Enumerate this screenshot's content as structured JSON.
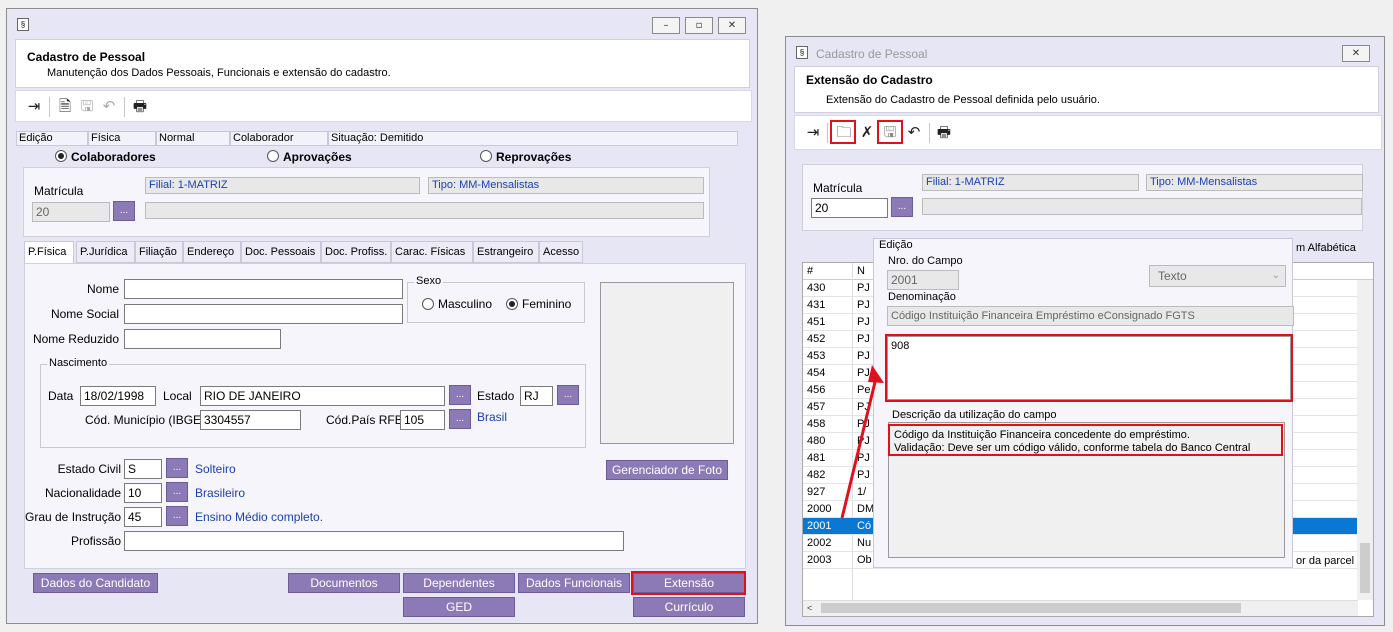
{
  "left": {
    "header": {
      "title": "Cadastro de Pessoal",
      "subtitle": "Manutenção dos Dados Pessoais, Funcionais e extensão do cadastro."
    },
    "status": [
      "Edição",
      "Física",
      "Normal",
      "Colaborador",
      "Situação: Demitido"
    ],
    "radios": [
      "Colaboradores",
      "Aprovações",
      "Reprovações"
    ],
    "matricula": {
      "label": "Matrícula",
      "value": "20",
      "filial": "Filial: 1-MATRIZ",
      "tipo": "Tipo: MM-Mensalistas"
    },
    "tabs": [
      "P.Física",
      "P.Jurídica",
      "Filiação",
      "Endereço",
      "Doc. Pessoais",
      "Doc. Profiss.",
      "Carac. Físicas",
      "Estrangeiro",
      "Acesso"
    ],
    "form": {
      "nome_label": "Nome",
      "nome_social_label": "Nome Social",
      "nome_reduzido_label": "Nome Reduzido",
      "sexo_label": "Sexo",
      "masculino": "Masculino",
      "feminino": "Feminino",
      "nascimento_label": "Nascimento",
      "data_label": "Data",
      "data_value": "18/02/1998",
      "local_label": "Local",
      "local_value": "RIO DE JANEIRO",
      "estado_label": "Estado",
      "estado_value": "RJ",
      "municipio_label": "Cód. Município (IBGE)",
      "municipio_value": "3304557",
      "pais_label": "Cód.País RFB",
      "pais_value": "105",
      "pais_desc": "Brasil",
      "estado_civil_label": "Estado Civil",
      "estado_civil_value": "S",
      "estado_civil_desc": "Solteiro",
      "nacionalidade_label": "Nacionalidade",
      "nacionalidade_value": "10",
      "nacionalidade_desc": "Brasileiro",
      "grau_label": "Grau de Instrução",
      "grau_value": "45",
      "grau_desc": "Ensino Médio completo.",
      "profissao_label": "Profissão",
      "foto_button": "Gerenciador de Foto"
    },
    "buttons": {
      "dados_candidato": "Dados do Candidato",
      "documentos": "Documentos",
      "dependentes": "Dependentes",
      "dados_funcionais": "Dados Funcionais",
      "extensao": "Extensão",
      "ged": "GED",
      "curriculo": "Currículo"
    },
    "lookup_glyph": "..."
  },
  "right": {
    "window_title": "Cadastro de Pessoal",
    "header": {
      "title": "Extensão do Cadastro",
      "subtitle": "Extensão do Cadastro de Pessoal definida pelo usuário."
    },
    "matricula": {
      "label": "Matrícula",
      "value": "20",
      "filial": "Filial: 1-MATRIZ",
      "tipo": "Tipo: MM-Mensalistas"
    },
    "grid": {
      "col_num": "#",
      "col_n": "N",
      "right_header": "m Alfabética",
      "rows": [
        {
          "num": "430",
          "n": "PJ"
        },
        {
          "num": "431",
          "n": "PJ"
        },
        {
          "num": "451",
          "n": "PJ"
        },
        {
          "num": "452",
          "n": "PJ"
        },
        {
          "num": "453",
          "n": "PJ"
        },
        {
          "num": "454",
          "n": "PJ"
        },
        {
          "num": "456",
          "n": "Pe"
        },
        {
          "num": "457",
          "n": "PJ"
        },
        {
          "num": "458",
          "n": "PJ"
        },
        {
          "num": "480",
          "n": "PJ"
        },
        {
          "num": "481",
          "n": "PJ"
        },
        {
          "num": "482",
          "n": "PJ"
        },
        {
          "num": "927",
          "n": "1/"
        },
        {
          "num": "2000",
          "n": "DM"
        },
        {
          "num": "2001",
          "n": "Có"
        },
        {
          "num": "2002",
          "n": "Nu"
        },
        {
          "num": "2003",
          "n": "Ob"
        }
      ],
      "right_last": "or da parcel"
    },
    "edit": {
      "group_label": "Edição",
      "nro_label": "Nro. do Campo",
      "nro_value": "2001",
      "tipo_value": "Texto",
      "denominacao_label": "Denominação",
      "denominacao_value": "Código Instituição Financeira Empréstimo eConsignado FGTS",
      "valor": "908",
      "descricao_label": "Descrição da utilização do campo",
      "descricao_line1": "Código da Instituição Financeira concedente do empréstimo.",
      "descricao_line2": "Validação: Deve ser um código válido, conforme tabela do Banco Central"
    }
  },
  "colors": {
    "accent_button": "#8c7ab6",
    "highlight": "#e0101d",
    "selection": "#0a78d2",
    "link": "#1b3fb3"
  }
}
